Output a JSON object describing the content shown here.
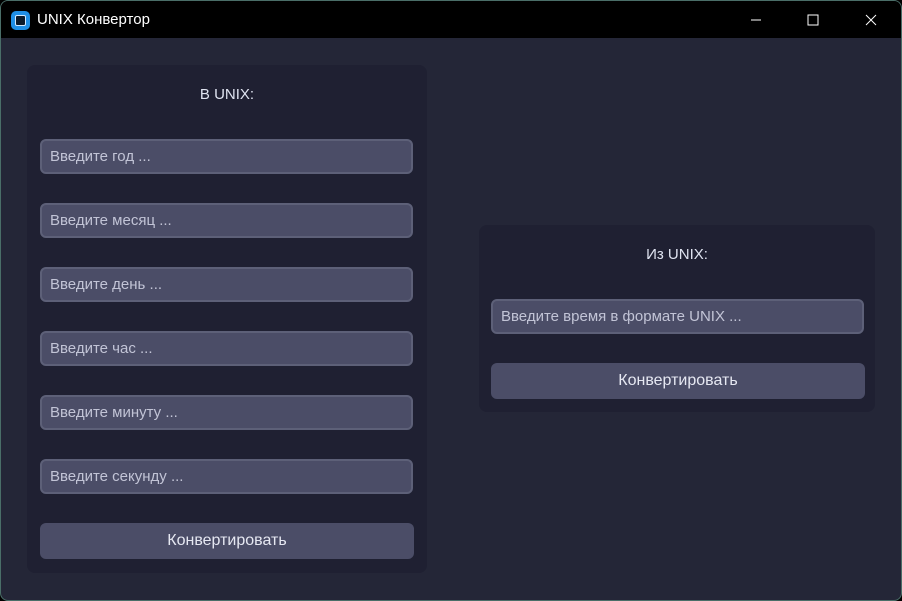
{
  "window": {
    "title": "UNIX Конвертор",
    "app_icon": "app-icon",
    "controls": [
      "minimize-icon",
      "maximize-icon",
      "close-icon"
    ]
  },
  "to_unix": {
    "heading": "В UNIX:",
    "fields": {
      "year": {
        "value": "",
        "placeholder": "Введите год ..."
      },
      "month": {
        "value": "",
        "placeholder": "Введите месяц ..."
      },
      "day": {
        "value": "",
        "placeholder": "Введите день ..."
      },
      "hour": {
        "value": "",
        "placeholder": "Введите час ..."
      },
      "minute": {
        "value": "",
        "placeholder": "Введите минуту ..."
      },
      "second": {
        "value": "",
        "placeholder": "Введите секунду ..."
      }
    },
    "convert_label": "Конвертировать"
  },
  "from_unix": {
    "heading": "Из UNIX:",
    "fields": {
      "timestamp": {
        "value": "",
        "placeholder": "Введите время в формате UNIX ..."
      }
    },
    "convert_label": "Конвертировать"
  },
  "colors": {
    "window_bg": "#242637",
    "panel_bg": "#1f2032",
    "field_bg": "#4b4d67",
    "titlebar_bg": "#000000",
    "accent": "#1f8fe6"
  }
}
